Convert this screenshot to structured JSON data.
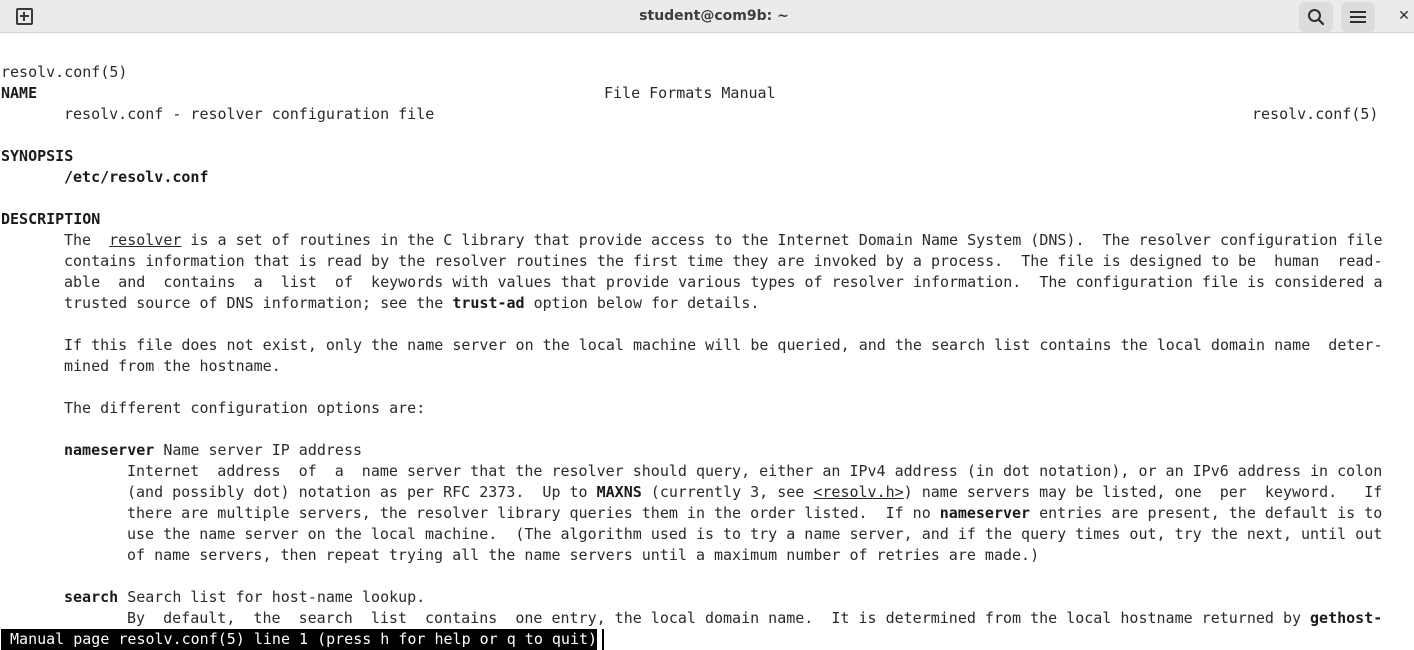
{
  "window": {
    "title": "student@com9b: ~"
  },
  "titlebar": {
    "new_tab_icon": "new-tab-icon",
    "search_icon": "search-icon",
    "menu_icon": "hamburger-menu-icon",
    "close_icon": "close-icon",
    "close_glyph": "✕"
  },
  "man": {
    "header_left": "resolv.conf(5)",
    "header_center": "File Formats Manual",
    "header_right": "resolv.conf(5)",
    "name_heading": "NAME",
    "name_text": "resolv.conf - resolver configuration file",
    "synopsis_heading": "SYNOPSIS",
    "synopsis_path": "/etc/resolv.conf",
    "description_heading": "DESCRIPTION",
    "desc": {
      "l1_a": "The  ",
      "l1_link": "resolver",
      "l1_b": " is a set of routines in the C library that provide access to the Internet Domain Name System (DNS).  The resolver configuration file",
      "l2": "contains information that is read by the resolver routines the first time they are invoked by a process.  The file is designed to be  human  read-",
      "l3": "able  and  contains  a  list  of  keywords with values that provide various types of resolver information.  The configuration file is considered a",
      "l4_a": "trusted source of DNS information; see the ",
      "l4_bold": "trust-ad",
      "l4_b": " option below for details.",
      "p2_l1": "If this file does not exist, only the name server on the local machine will be queried, and the search list contains the local domain name  deter-",
      "p2_l2": "mined from the hostname.",
      "p3": "The different configuration options are:"
    },
    "nameserver": {
      "keyword": "nameserver",
      "title": " Name server IP address",
      "l1": "Internet  address  of  a  name server that the resolver should query, either an IPv4 address (in dot notation), or an IPv6 address in colon",
      "l2_a": "(and possibly dot) notation as per RFC 2373.  Up to ",
      "l2_bold": "MAXNS",
      "l2_b": " (currently 3, see ",
      "l2_link": "<resolv.h>",
      "l2_c": ") name servers may be listed, one  per  keyword.   If",
      "l3_a": "there are multiple servers, the resolver library queries them in the order listed.  If no ",
      "l3_bold": "nameserver",
      "l3_b": " entries are present, the default is to",
      "l4": "use the name server on the local machine.  (The algorithm used is to try a name server, and if the query times out, try the next, until out",
      "l5": "of name servers, then repeat trying all the name servers until a maximum number of retries are made.)"
    },
    "search": {
      "keyword": "search",
      "title": " Search list for host-name lookup.",
      "l1_a": "By  default,  the  search  list  contains  one entry, the local domain name.  It is determined from the local hostname returned by ",
      "l1_bold": "gethost-"
    },
    "status_line": " Manual page resolv.conf(5) line 1 (press h for help or q to quit)"
  }
}
